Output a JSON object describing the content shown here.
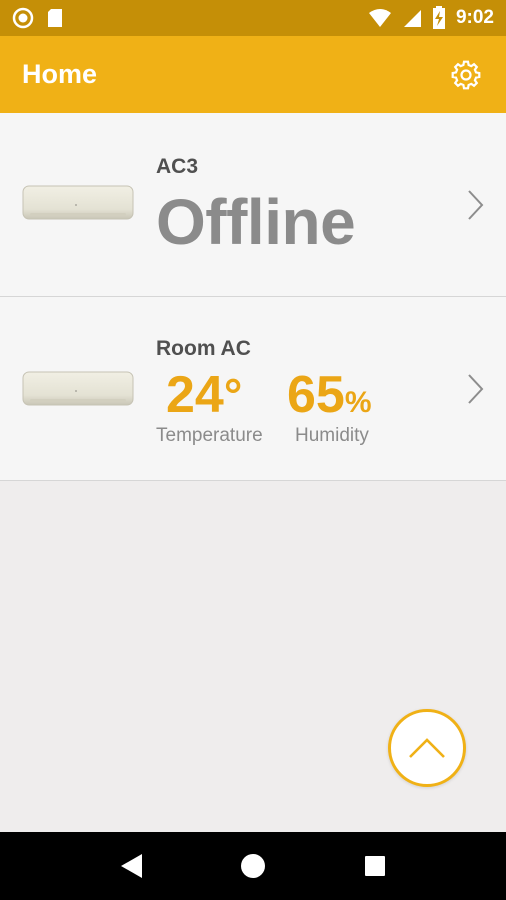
{
  "status_bar": {
    "time": "9:02",
    "icons": [
      "record-icon",
      "sd-card-icon",
      "wifi-icon",
      "signal-icon",
      "battery-charging-icon"
    ]
  },
  "app_bar": {
    "title": "Home",
    "settings_icon": "gear-icon"
  },
  "devices": [
    {
      "name": "AC3",
      "status": "Offline"
    },
    {
      "name": "Room AC",
      "temperature": {
        "value": "24",
        "unit": "°",
        "label": "Temperature"
      },
      "humidity": {
        "value": "65",
        "unit": "%",
        "label": "Humidity"
      }
    }
  ],
  "fab": {
    "icon": "chevron-up-icon"
  },
  "nav_bar": {
    "icons": [
      "back-icon",
      "home-icon",
      "recents-icon"
    ]
  },
  "colors": {
    "status_bar": "#c58f07",
    "app_bar": "#f0b116",
    "accent_value": "#eba616",
    "offline_text": "#8b8b8b"
  }
}
